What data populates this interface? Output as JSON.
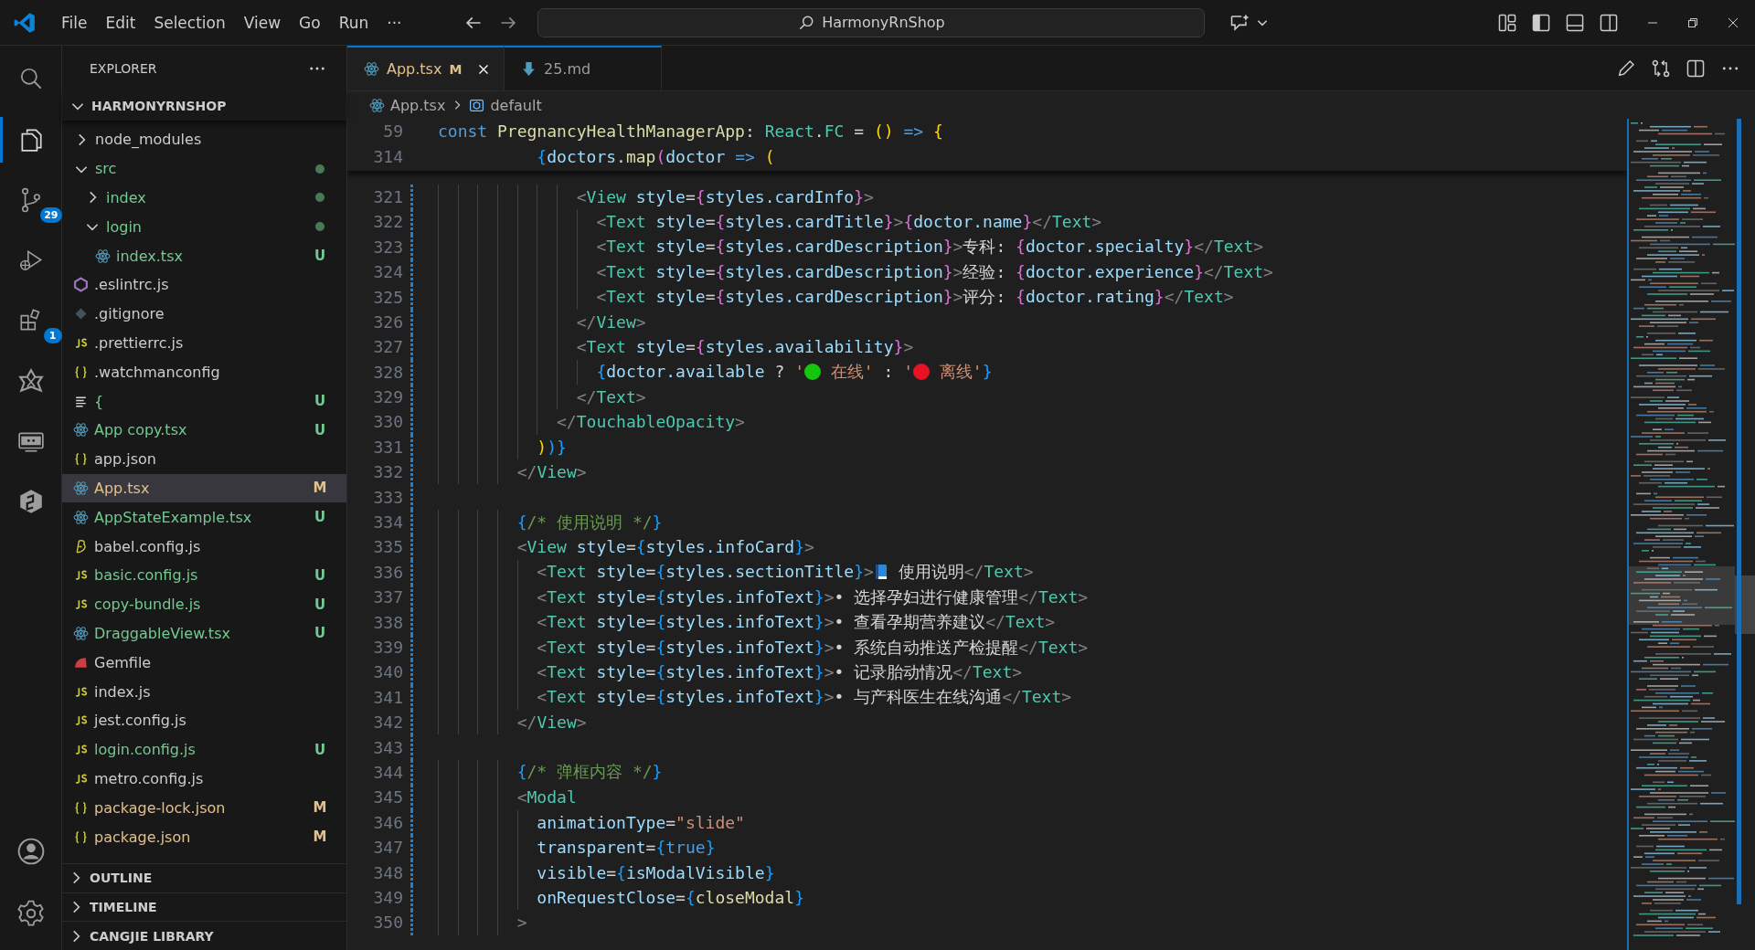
{
  "title_bar": {
    "menu": [
      "File",
      "Edit",
      "Selection",
      "View",
      "Go",
      "Run",
      "···"
    ],
    "search": {
      "value": "HarmonyRnShop"
    }
  },
  "activity_bar": {
    "items": [
      {
        "kind": "search",
        "selected": false
      },
      {
        "kind": "files",
        "selected": true
      },
      {
        "kind": "source-control",
        "selected": false,
        "badge": "29"
      },
      {
        "kind": "run",
        "selected": false
      },
      {
        "kind": "extensions",
        "selected": false,
        "badge": "1"
      },
      {
        "kind": "star",
        "selected": false
      },
      {
        "kind": "remote",
        "selected": false
      },
      {
        "kind": "hexagon",
        "selected": false
      }
    ],
    "bottom": [
      {
        "kind": "account"
      },
      {
        "kind": "settings"
      }
    ]
  },
  "explorer": {
    "title": "EXPLORER",
    "root": {
      "name": "HARMONYRNSHOP",
      "expanded": true
    },
    "items": [
      {
        "name": "node_modules",
        "kind": "folder",
        "expanded": false,
        "color": "#cccccc",
        "dot": false,
        "selected": false
      },
      {
        "name": "src",
        "kind": "folder",
        "expanded": true,
        "color": "#73c991",
        "dot": true,
        "selected": false,
        "children": [
          {
            "name": "index",
            "kind": "folder",
            "expanded": false,
            "color": "#73c991",
            "dot": true,
            "selected": false
          },
          {
            "name": "login",
            "kind": "folder",
            "expanded": true,
            "color": "#73c991",
            "dot": true,
            "selected": false,
            "children": [
              {
                "name": "index.tsx",
                "kind": "react",
                "color": "#73c991",
                "badge": "U",
                "selected": false
              }
            ]
          }
        ]
      },
      {
        "name": ".eslintrc.js",
        "kind": "eslint",
        "color": "#cccccc",
        "selected": false
      },
      {
        "name": ".gitignore",
        "kind": "git",
        "color": "#cccccc",
        "selected": false
      },
      {
        "name": ".prettierrc.js",
        "kind": "js",
        "color": "#cccccc",
        "selected": false
      },
      {
        "name": ".watchmanconfig",
        "kind": "json",
        "color": "#cccccc",
        "selected": false
      },
      {
        "name": "{",
        "kind": "lines",
        "color": "#73c991",
        "badge": "U",
        "selected": false
      },
      {
        "name": "App copy.tsx",
        "kind": "react",
        "color": "#73c991",
        "badge": "U",
        "selected": false
      },
      {
        "name": "app.json",
        "kind": "json",
        "color": "#cccccc",
        "selected": false
      },
      {
        "name": "App.tsx",
        "kind": "react",
        "color": "#e2c08d",
        "badge": "M",
        "selected": true
      },
      {
        "name": "AppStateExample.tsx",
        "kind": "react",
        "color": "#73c991",
        "badge": "U",
        "selected": false
      },
      {
        "name": "babel.config.js",
        "kind": "babel",
        "color": "#cccccc",
        "selected": false
      },
      {
        "name": "basic.config.js",
        "kind": "js",
        "color": "#73c991",
        "badge": "U",
        "selected": false
      },
      {
        "name": "copy-bundle.js",
        "kind": "js",
        "color": "#73c991",
        "badge": "U",
        "selected": false
      },
      {
        "name": "DraggableView.tsx",
        "kind": "react",
        "color": "#73c991",
        "badge": "U",
        "selected": false
      },
      {
        "name": "Gemfile",
        "kind": "gem",
        "color": "#cccccc",
        "selected": false
      },
      {
        "name": "index.js",
        "kind": "js",
        "color": "#cccccc",
        "selected": false
      },
      {
        "name": "jest.config.js",
        "kind": "js",
        "color": "#cccccc",
        "selected": false
      },
      {
        "name": "login.config.js",
        "kind": "js",
        "color": "#73c991",
        "badge": "U",
        "selected": false
      },
      {
        "name": "metro.config.js",
        "kind": "js",
        "color": "#cccccc",
        "selected": false
      },
      {
        "name": "package-lock.json",
        "kind": "json",
        "color": "#e2c08d",
        "badge": "M",
        "selected": false
      },
      {
        "name": "package.json",
        "kind": "json",
        "color": "#e2c08d",
        "badge": "M",
        "selected": false
      }
    ],
    "sections": [
      {
        "title": "OUTLINE",
        "expanded": false
      },
      {
        "title": "TIMELINE",
        "expanded": false
      },
      {
        "title": "CANGJIE LIBRARY",
        "expanded": false
      }
    ]
  },
  "editor": {
    "tabs": [
      {
        "name": "App.tsx",
        "kind": "react",
        "status": "M",
        "selected": true
      },
      {
        "name": "25.md",
        "kind": "markdown",
        "selected": false
      }
    ],
    "breadcrumb": [
      {
        "kind": "react",
        "text": "App.tsx"
      },
      {
        "kind": "symbol",
        "text": "default"
      }
    ],
    "sticky_lines": [
      {
        "number": "59",
        "tokens": [
          {
            "kind": "kw",
            "text": "const"
          },
          {
            "kind": "fn",
            "text": " PregnancyHealthManagerApp"
          },
          {
            "kind": "p",
            "text": ": "
          },
          {
            "kind": "type",
            "text": "React"
          },
          {
            "kind": "p",
            "text": "."
          },
          {
            "kind": "type",
            "text": "FC"
          },
          {
            "kind": "p",
            "text": " = "
          },
          {
            "kind": "b1",
            "text": "()"
          },
          {
            "kind": "kw",
            "text": " =>"
          },
          {
            "kind": "b1",
            "text": " {"
          }
        ]
      },
      {
        "number": "314",
        "tokens": [
          {
            "kind": "b3",
            "text": "          {"
          },
          {
            "kind": "var",
            "text": "doctors"
          },
          {
            "kind": "p",
            "text": "."
          },
          {
            "kind": "fn",
            "text": "map"
          },
          {
            "kind": "b2",
            "text": "("
          },
          {
            "kind": "var",
            "text": "doctor"
          },
          {
            "kind": "kw",
            "text": " =>"
          },
          {
            "kind": "b1",
            "text": " ("
          }
        ]
      }
    ],
    "lines": [
      {
        "number": "321",
        "tokens": [
          {
            "kind": "ang",
            "text": "              <"
          },
          {
            "kind": "tag",
            "text": "View"
          },
          {
            "kind": "attr",
            "text": " style"
          },
          {
            "kind": "p",
            "text": "="
          },
          {
            "kind": "b2",
            "text": "{"
          },
          {
            "kind": "var",
            "text": "styles.cardInfo"
          },
          {
            "kind": "b2",
            "text": "}"
          },
          {
            "kind": "ang",
            "text": ">"
          }
        ]
      },
      {
        "number": "322",
        "tokens": [
          {
            "kind": "ang",
            "text": "                <"
          },
          {
            "kind": "tag",
            "text": "Text"
          },
          {
            "kind": "attr",
            "text": " style"
          },
          {
            "kind": "p",
            "text": "="
          },
          {
            "kind": "b2",
            "text": "{"
          },
          {
            "kind": "var",
            "text": "styles.cardTitle"
          },
          {
            "kind": "b2",
            "text": "}"
          },
          {
            "kind": "ang",
            "text": ">"
          },
          {
            "kind": "b2",
            "text": "{"
          },
          {
            "kind": "var",
            "text": "doctor.name"
          },
          {
            "kind": "b2",
            "text": "}"
          },
          {
            "kind": "ang",
            "text": "</"
          },
          {
            "kind": "tag",
            "text": "Text"
          },
          {
            "kind": "ang",
            "text": ">"
          }
        ]
      },
      {
        "number": "323",
        "tokens": [
          {
            "kind": "ang",
            "text": "                <"
          },
          {
            "kind": "tag",
            "text": "Text"
          },
          {
            "kind": "attr",
            "text": " style"
          },
          {
            "kind": "p",
            "text": "="
          },
          {
            "kind": "b2",
            "text": "{"
          },
          {
            "kind": "var",
            "text": "styles.cardDescription"
          },
          {
            "kind": "b2",
            "text": "}"
          },
          {
            "kind": "ang",
            "text": ">"
          },
          {
            "kind": "txt",
            "text": "专科: "
          },
          {
            "kind": "b2",
            "text": "{"
          },
          {
            "kind": "var",
            "text": "doctor.specialty"
          },
          {
            "kind": "b2",
            "text": "}"
          },
          {
            "kind": "ang",
            "text": "</"
          },
          {
            "kind": "tag",
            "text": "Text"
          },
          {
            "kind": "ang",
            "text": ">"
          }
        ]
      },
      {
        "number": "324",
        "tokens": [
          {
            "kind": "ang",
            "text": "                <"
          },
          {
            "kind": "tag",
            "text": "Text"
          },
          {
            "kind": "attr",
            "text": " style"
          },
          {
            "kind": "p",
            "text": "="
          },
          {
            "kind": "b2",
            "text": "{"
          },
          {
            "kind": "var",
            "text": "styles.cardDescription"
          },
          {
            "kind": "b2",
            "text": "}"
          },
          {
            "kind": "ang",
            "text": ">"
          },
          {
            "kind": "txt",
            "text": "经验: "
          },
          {
            "kind": "b2",
            "text": "{"
          },
          {
            "kind": "var",
            "text": "doctor.experience"
          },
          {
            "kind": "b2",
            "text": "}"
          },
          {
            "kind": "ang",
            "text": "</"
          },
          {
            "kind": "tag",
            "text": "Text"
          },
          {
            "kind": "ang",
            "text": ">"
          }
        ]
      },
      {
        "number": "325",
        "tokens": [
          {
            "kind": "ang",
            "text": "                <"
          },
          {
            "kind": "tag",
            "text": "Text"
          },
          {
            "kind": "attr",
            "text": " style"
          },
          {
            "kind": "p",
            "text": "="
          },
          {
            "kind": "b2",
            "text": "{"
          },
          {
            "kind": "var",
            "text": "styles.cardDescription"
          },
          {
            "kind": "b2",
            "text": "}"
          },
          {
            "kind": "ang",
            "text": ">"
          },
          {
            "kind": "txt",
            "text": "评分: "
          },
          {
            "kind": "b2",
            "text": "{"
          },
          {
            "kind": "var",
            "text": "doctor.rating"
          },
          {
            "kind": "b2",
            "text": "}"
          },
          {
            "kind": "ang",
            "text": "</"
          },
          {
            "kind": "tag",
            "text": "Text"
          },
          {
            "kind": "ang",
            "text": ">"
          }
        ]
      },
      {
        "number": "326",
        "tokens": [
          {
            "kind": "ang",
            "text": "              </"
          },
          {
            "kind": "tag",
            "text": "View"
          },
          {
            "kind": "ang",
            "text": ">"
          }
        ]
      },
      {
        "number": "327",
        "tokens": [
          {
            "kind": "ang",
            "text": "              <"
          },
          {
            "kind": "tag",
            "text": "Text"
          },
          {
            "kind": "attr",
            "text": " style"
          },
          {
            "kind": "p",
            "text": "="
          },
          {
            "kind": "b2",
            "text": "{"
          },
          {
            "kind": "var",
            "text": "styles.availability"
          },
          {
            "kind": "b2",
            "text": "}"
          },
          {
            "kind": "ang",
            "text": ">"
          }
        ]
      },
      {
        "number": "328",
        "tokens": [
          {
            "kind": "b3",
            "text": "                {"
          },
          {
            "kind": "var",
            "text": "doctor.available"
          },
          {
            "kind": "p",
            "text": " ? "
          },
          {
            "kind": "str",
            "text": "'"
          },
          {
            "kind": "dot",
            "color": "#16c60c"
          },
          {
            "kind": "str",
            "text": " 在线'"
          },
          {
            "kind": "p",
            "text": " : "
          },
          {
            "kind": "str",
            "text": "'"
          },
          {
            "kind": "dot",
            "color": "#e81224"
          },
          {
            "kind": "str",
            "text": " 离线'"
          },
          {
            "kind": "b3",
            "text": "}"
          }
        ]
      },
      {
        "number": "329",
        "tokens": [
          {
            "kind": "ang",
            "text": "              </"
          },
          {
            "kind": "tag",
            "text": "Text"
          },
          {
            "kind": "ang",
            "text": ">"
          }
        ]
      },
      {
        "number": "330",
        "tokens": [
          {
            "kind": "ang",
            "text": "            </"
          },
          {
            "kind": "tag",
            "text": "TouchableOpacity"
          },
          {
            "kind": "ang",
            "text": ">"
          }
        ]
      },
      {
        "number": "331",
        "tokens": [
          {
            "kind": "b1",
            "text": "          )"
          },
          {
            "kind": "b3",
            "text": ")}"
          }
        ]
      },
      {
        "number": "332",
        "tokens": [
          {
            "kind": "ang",
            "text": "        </"
          },
          {
            "kind": "tag",
            "text": "View"
          },
          {
            "kind": "ang",
            "text": ">"
          }
        ]
      },
      {
        "number": "333"
      },
      {
        "number": "334",
        "tokens": [
          {
            "kind": "b3",
            "text": "        {"
          },
          {
            "kind": "cmt",
            "text": "/* 使用说明 */"
          },
          {
            "kind": "b3",
            "text": "}"
          }
        ]
      },
      {
        "number": "335",
        "tokens": [
          {
            "kind": "ang",
            "text": "        <"
          },
          {
            "kind": "tag",
            "text": "View"
          },
          {
            "kind": "attr",
            "text": " style"
          },
          {
            "kind": "p",
            "text": "="
          },
          {
            "kind": "b3",
            "text": "{"
          },
          {
            "kind": "var",
            "text": "styles.infoCard"
          },
          {
            "kind": "b3",
            "text": "}"
          },
          {
            "kind": "ang",
            "text": ">"
          }
        ]
      },
      {
        "number": "336",
        "tokens": [
          {
            "kind": "ang",
            "text": "          <"
          },
          {
            "kind": "tag",
            "text": "Text"
          },
          {
            "kind": "attr",
            "text": " style"
          },
          {
            "kind": "p",
            "text": "="
          },
          {
            "kind": "b3",
            "text": "{"
          },
          {
            "kind": "var",
            "text": "styles.sectionTitle"
          },
          {
            "kind": "b3",
            "text": "}"
          },
          {
            "kind": "ang",
            "text": ">"
          },
          {
            "kind": "book",
            "color": "#2b88d8"
          },
          {
            "kind": "txt",
            "text": " 使用说明"
          },
          {
            "kind": "ang",
            "text": "</"
          },
          {
            "kind": "tag",
            "text": "Text"
          },
          {
            "kind": "ang",
            "text": ">"
          }
        ]
      },
      {
        "number": "337",
        "tokens": [
          {
            "kind": "ang",
            "text": "          <"
          },
          {
            "kind": "tag",
            "text": "Text"
          },
          {
            "kind": "attr",
            "text": " style"
          },
          {
            "kind": "p",
            "text": "="
          },
          {
            "kind": "b3",
            "text": "{"
          },
          {
            "kind": "var",
            "text": "styles.infoText"
          },
          {
            "kind": "b3",
            "text": "}"
          },
          {
            "kind": "ang",
            "text": ">"
          },
          {
            "kind": "txt",
            "text": "• 选择孕妇进行健康管理"
          },
          {
            "kind": "ang",
            "text": "</"
          },
          {
            "kind": "tag",
            "text": "Text"
          },
          {
            "kind": "ang",
            "text": ">"
          }
        ]
      },
      {
        "number": "338",
        "tokens": [
          {
            "kind": "ang",
            "text": "          <"
          },
          {
            "kind": "tag",
            "text": "Text"
          },
          {
            "kind": "attr",
            "text": " style"
          },
          {
            "kind": "p",
            "text": "="
          },
          {
            "kind": "b3",
            "text": "{"
          },
          {
            "kind": "var",
            "text": "styles.infoText"
          },
          {
            "kind": "b3",
            "text": "}"
          },
          {
            "kind": "ang",
            "text": ">"
          },
          {
            "kind": "txt",
            "text": "• 查看孕期营养建议"
          },
          {
            "kind": "ang",
            "text": "</"
          },
          {
            "kind": "tag",
            "text": "Text"
          },
          {
            "kind": "ang",
            "text": ">"
          }
        ]
      },
      {
        "number": "339",
        "tokens": [
          {
            "kind": "ang",
            "text": "          <"
          },
          {
            "kind": "tag",
            "text": "Text"
          },
          {
            "kind": "attr",
            "text": " style"
          },
          {
            "kind": "p",
            "text": "="
          },
          {
            "kind": "b3",
            "text": "{"
          },
          {
            "kind": "var",
            "text": "styles.infoText"
          },
          {
            "kind": "b3",
            "text": "}"
          },
          {
            "kind": "ang",
            "text": ">"
          },
          {
            "kind": "txt",
            "text": "• 系统自动推送产检提醒"
          },
          {
            "kind": "ang",
            "text": "</"
          },
          {
            "kind": "tag",
            "text": "Text"
          },
          {
            "kind": "ang",
            "text": ">"
          }
        ]
      },
      {
        "number": "340",
        "tokens": [
          {
            "kind": "ang",
            "text": "          <"
          },
          {
            "kind": "tag",
            "text": "Text"
          },
          {
            "kind": "attr",
            "text": " style"
          },
          {
            "kind": "p",
            "text": "="
          },
          {
            "kind": "b3",
            "text": "{"
          },
          {
            "kind": "var",
            "text": "styles.infoText"
          },
          {
            "kind": "b3",
            "text": "}"
          },
          {
            "kind": "ang",
            "text": ">"
          },
          {
            "kind": "txt",
            "text": "• 记录胎动情况"
          },
          {
            "kind": "ang",
            "text": "</"
          },
          {
            "kind": "tag",
            "text": "Text"
          },
          {
            "kind": "ang",
            "text": ">"
          }
        ]
      },
      {
        "number": "341",
        "tokens": [
          {
            "kind": "ang",
            "text": "          <"
          },
          {
            "kind": "tag",
            "text": "Text"
          },
          {
            "kind": "attr",
            "text": " style"
          },
          {
            "kind": "p",
            "text": "="
          },
          {
            "kind": "b3",
            "text": "{"
          },
          {
            "kind": "var",
            "text": "styles.infoText"
          },
          {
            "kind": "b3",
            "text": "}"
          },
          {
            "kind": "ang",
            "text": ">"
          },
          {
            "kind": "txt",
            "text": "• 与产科医生在线沟通"
          },
          {
            "kind": "ang",
            "text": "</"
          },
          {
            "kind": "tag",
            "text": "Text"
          },
          {
            "kind": "ang",
            "text": ">"
          }
        ]
      },
      {
        "number": "342",
        "tokens": [
          {
            "kind": "ang",
            "text": "        </"
          },
          {
            "kind": "tag",
            "text": "View"
          },
          {
            "kind": "ang",
            "text": ">"
          }
        ]
      },
      {
        "number": "343"
      },
      {
        "number": "344",
        "tokens": [
          {
            "kind": "b3",
            "text": "        {"
          },
          {
            "kind": "cmt",
            "text": "/* 弹框内容 */"
          },
          {
            "kind": "b3",
            "text": "}"
          }
        ]
      },
      {
        "number": "345",
        "tokens": [
          {
            "kind": "ang",
            "text": "        <"
          },
          {
            "kind": "tag",
            "text": "Modal"
          }
        ]
      },
      {
        "number": "346",
        "tokens": [
          {
            "kind": "attr",
            "text": "          animationType"
          },
          {
            "kind": "p",
            "text": "="
          },
          {
            "kind": "str",
            "text": "\"slide\""
          }
        ]
      },
      {
        "number": "347",
        "tokens": [
          {
            "kind": "attr",
            "text": "          transparent"
          },
          {
            "kind": "p",
            "text": "="
          },
          {
            "kind": "b3",
            "text": "{"
          },
          {
            "kind": "kw",
            "text": "true"
          },
          {
            "kind": "b3",
            "text": "}"
          }
        ]
      },
      {
        "number": "348",
        "tokens": [
          {
            "kind": "attr",
            "text": "          visible"
          },
          {
            "kind": "p",
            "text": "="
          },
          {
            "kind": "b3",
            "text": "{"
          },
          {
            "kind": "var",
            "text": "isModalVisible"
          },
          {
            "kind": "b3",
            "text": "}"
          }
        ]
      },
      {
        "number": "349",
        "tokens": [
          {
            "kind": "attr",
            "text": "          onRequestClose"
          },
          {
            "kind": "p",
            "text": "="
          },
          {
            "kind": "b3",
            "text": "{"
          },
          {
            "kind": "fn",
            "text": "closeModal"
          },
          {
            "kind": "b3",
            "text": "}"
          }
        ]
      },
      {
        "number": "350",
        "tokens": [
          {
            "kind": "ang",
            "text": "        >"
          }
        ]
      }
    ]
  }
}
